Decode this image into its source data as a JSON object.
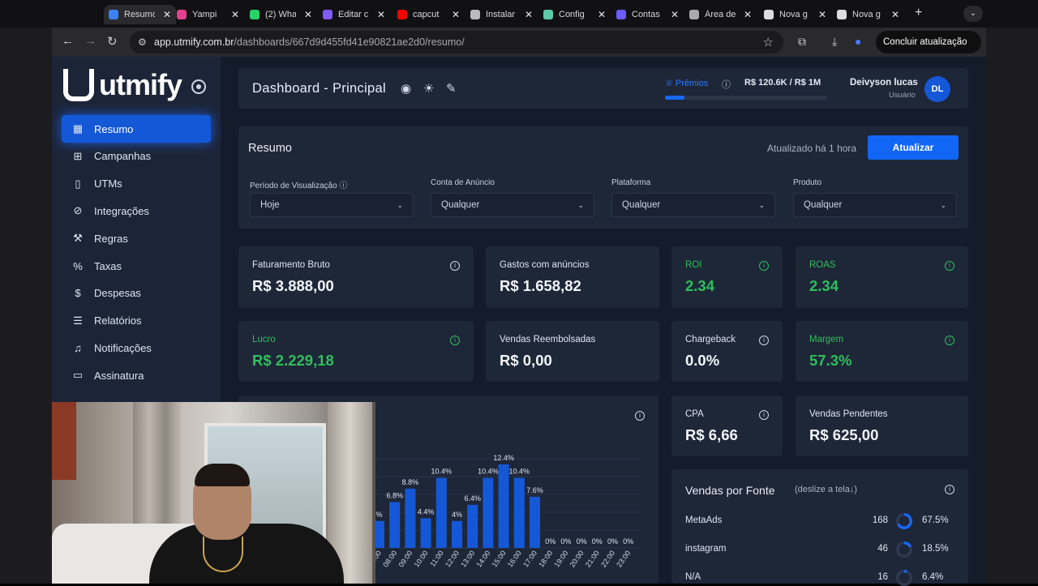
{
  "browser": {
    "tabs": [
      {
        "label": "Resumo",
        "color": "#3b82f6",
        "active": true
      },
      {
        "label": "Yampi",
        "color": "#e0408f",
        "active": false
      },
      {
        "label": "(2) Wha",
        "color": "#25d366",
        "active": false
      },
      {
        "label": "Editar c",
        "color": "#7c5cff",
        "active": false
      },
      {
        "label": "capcut",
        "color": "#ff0000",
        "active": false
      },
      {
        "label": "Instalar",
        "color": "#bbbbbb",
        "active": false
      },
      {
        "label": "Config",
        "color": "#5dcaa5",
        "active": false
      },
      {
        "label": "Contas",
        "color": "#6b5cff",
        "active": false
      },
      {
        "label": "Área de",
        "color": "#aaaaaa",
        "active": false
      },
      {
        "label": "Nova g",
        "color": "#dddddd",
        "active": false
      },
      {
        "label": "Nova g",
        "color": "#dddddd",
        "active": false
      }
    ],
    "url_host": "app.utmify.com.br",
    "url_path": "/dashboards/667d9d455fd41e90821ae2d0/resumo/",
    "update_button": "Concluir atualização"
  },
  "sidebar": {
    "logo_text": "utmify",
    "items": [
      {
        "label": "Resumo",
        "icon": "layout-icon",
        "glyph": "▦",
        "active": true
      },
      {
        "label": "Campanhas",
        "icon": "folder-plus-icon",
        "glyph": "⊞",
        "active": false
      },
      {
        "label": "UTMs",
        "icon": "clipboard-icon",
        "glyph": "▯",
        "active": false
      },
      {
        "label": "Integrações",
        "icon": "link-icon",
        "glyph": "⊘",
        "active": false
      },
      {
        "label": "Regras",
        "icon": "wrench-icon",
        "glyph": "⚒",
        "active": false
      },
      {
        "label": "Taxas",
        "icon": "percent-icon",
        "glyph": "%",
        "active": false
      },
      {
        "label": "Despesas",
        "icon": "dollar-icon",
        "glyph": "$",
        "active": false
      },
      {
        "label": "Relatórios",
        "icon": "file-text-icon",
        "glyph": "☰",
        "active": false
      },
      {
        "label": "Notificações",
        "icon": "bell-icon",
        "glyph": "♫",
        "active": false
      },
      {
        "label": "Assinatura",
        "icon": "credit-card-icon",
        "glyph": "▭",
        "active": false
      }
    ]
  },
  "header": {
    "title": "Dashboard - Principal",
    "premios_label": "Prêmios",
    "premios_value": "R$ 120.6K  /  R$ 1M",
    "premios_progress": 0.12,
    "user_name": "Deivyson lucas",
    "user_role": "Usuário",
    "avatar_initials": "DL"
  },
  "resumo": {
    "title": "Resumo",
    "updated": "Atualizado há 1 hora",
    "button": "Atualizar",
    "filters": [
      {
        "label": "Período de Visualização",
        "value": "Hoje",
        "info": true
      },
      {
        "label": "Conta de Anúncio",
        "value": "Qualquer",
        "info": false
      },
      {
        "label": "Plataforma",
        "value": "Qualquer",
        "info": false
      },
      {
        "label": "Produto",
        "value": "Qualquer",
        "info": false
      }
    ]
  },
  "metrics": {
    "faturamento": {
      "label": "Faturamento Bruto",
      "value": "R$ 3.888,00"
    },
    "gastos": {
      "label": "Gastos com anúncios",
      "value": "R$ 1.658,82"
    },
    "roi": {
      "label": "ROI",
      "value": "2.34"
    },
    "roas": {
      "label": "ROAS",
      "value": "2.34"
    },
    "lucro": {
      "label": "Lucro",
      "value": "R$ 2.229,18"
    },
    "reembolsadas": {
      "label": "Vendas Reembolsadas",
      "value": "R$ 0,00"
    },
    "chargeback": {
      "label": "Chargeback",
      "value": "0.0%"
    },
    "margem": {
      "label": "Margem",
      "value": "57.3%"
    },
    "cpa": {
      "label": "CPA",
      "value": "R$ 6,66"
    },
    "pendentes": {
      "label": "Vendas Pendentes",
      "value": "R$ 625,00"
    }
  },
  "chart_data": {
    "type": "bar",
    "categories": [
      "07:00",
      "08:00",
      "09:00",
      "10:00",
      "11:00",
      "12:00",
      "13:00",
      "14:00",
      "15:00",
      "16:00",
      "17:00",
      "18:00",
      "19:00",
      "20:00",
      "21:00",
      "22:00",
      "23:00"
    ],
    "values": [
      4.0,
      6.8,
      8.8,
      4.4,
      10.4,
      4.0,
      6.4,
      10.4,
      12.4,
      10.4,
      7.6,
      0,
      0,
      0,
      0,
      0,
      0
    ],
    "labels": [
      "%",
      "6.8%",
      "8.8%",
      "4.4%",
      "10.4%",
      "4%",
      "6.4%",
      "10.4%",
      "12.4%",
      "10.4%",
      "7.6%",
      "0%",
      "0%",
      "0%",
      "0%",
      "0%",
      "0%"
    ],
    "color": "#1458d8",
    "ylim": [
      0,
      13
    ]
  },
  "fonte": {
    "title": "Vendas por Fonte",
    "hint": "(deslize a tela↓)",
    "rows": [
      {
        "name": "MetaAds",
        "count": "168",
        "pct": "67.5%",
        "ratio": 0.675
      },
      {
        "name": "instagram",
        "count": "46",
        "pct": "18.5%",
        "ratio": 0.185
      },
      {
        "name": "N/A",
        "count": "16",
        "pct": "6.4%",
        "ratio": 0.064
      }
    ]
  },
  "colors": {
    "accent": "#1458d8",
    "positive": "#2fbf5b",
    "panel": "#1e2738",
    "background": "#141b2b"
  }
}
